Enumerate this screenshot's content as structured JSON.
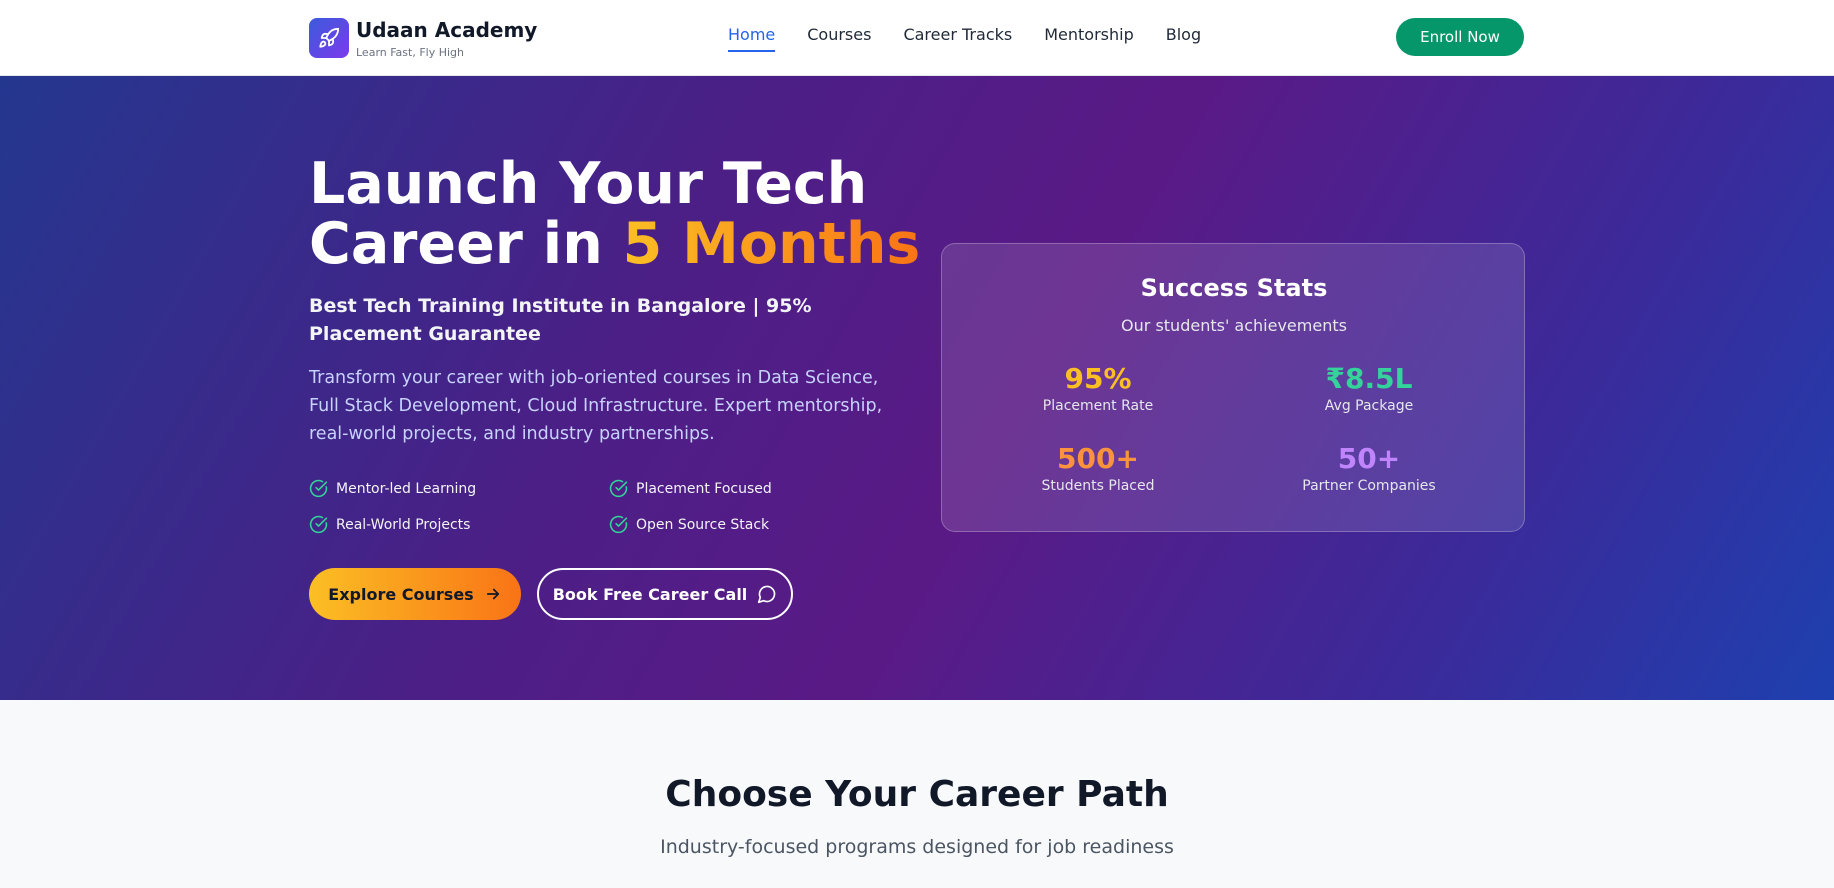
{
  "brand": {
    "name": "Udaan Academy",
    "tagline": "Learn Fast, Fly High",
    "icon": "rocket-icon"
  },
  "nav": {
    "links": [
      "Home",
      "Courses",
      "Career Tracks",
      "Mentorship",
      "Blog"
    ],
    "active": "Home",
    "cta": "Enroll Now"
  },
  "hero": {
    "title_line1": "Launch Your Tech",
    "title_line2_prefix": "Career in ",
    "title_highlight": "5 Months",
    "subtitle": "Best Tech Training Institute in Bangalore | 95% Placement Guarantee",
    "description": "Transform your career with job-oriented courses in Data Science, Full Stack Development, Cloud Infrastructure. Expert mentorship, real-world projects, and industry partnerships.",
    "features": [
      "Mentor-led Learning",
      "Placement Focused",
      "Real-World Projects",
      "Open Source Stack"
    ],
    "primary_button": "Explore Courses",
    "secondary_button": "Book Free Career Call"
  },
  "stats": {
    "title": "Success Stats",
    "subtitle": "Our students' achievements",
    "items": [
      {
        "value": "95%",
        "label": "Placement Rate",
        "color": "#fbbf24"
      },
      {
        "value": "₹8.5L",
        "label": "Avg Package",
        "color": "#34d399"
      },
      {
        "value": "500+",
        "label": "Students Placed",
        "color": "#fb923c"
      },
      {
        "value": "50+",
        "label": "Partner Companies",
        "color": "#c084fc"
      }
    ]
  },
  "career_section": {
    "title": "Choose Your Career Path",
    "subtitle": "Industry-focused programs designed for job readiness"
  },
  "colors": {
    "accent_green": "#059669",
    "nav_active": "#2563eb",
    "highlight_gradient": [
      "#fbbf24",
      "#f97316"
    ],
    "check_color": "#34d399"
  }
}
